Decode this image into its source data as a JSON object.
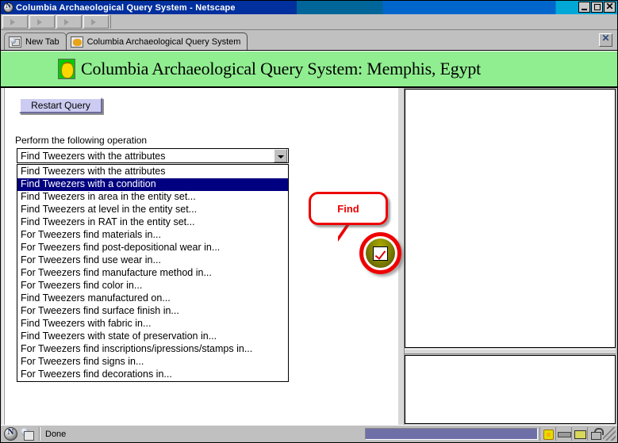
{
  "window": {
    "title": "Columbia Archaeological Query System - Netscape",
    "app_icon": "netscape-icon",
    "minimize_label": "",
    "maximize_label": "",
    "close_label": "✕"
  },
  "navbar": {
    "buttons": [
      "nav-button-1",
      "nav-button-2",
      "nav-button-3",
      "nav-button-4"
    ]
  },
  "tabs": [
    {
      "label": "New Tab",
      "icon": "new-tab-icon",
      "active": false
    },
    {
      "label": "Columbia Archaeological Query System",
      "icon": "scarab-icon",
      "active": true
    }
  ],
  "tab_close_label": "✕",
  "page": {
    "logo_icon": "scarab-logo-icon",
    "title": "Columbia Archaeological Query System: Memphis, Egypt",
    "header_bg": "#90ee90"
  },
  "form": {
    "restart_button": "Restart Query",
    "operation_label": "Perform the following operation",
    "selected_option": "Find Tweezers with the attributes",
    "dropdown_arrow_icon": "chevron-down-icon",
    "options": [
      {
        "label": "Find Tweezers with the attributes",
        "selected": false
      },
      {
        "label": "Find Tweezers with a condition",
        "selected": true
      },
      {
        "label": "Find Tweezers in area in the entity set...",
        "selected": false
      },
      {
        "label": "Find Tweezers at level in the entity set...",
        "selected": false
      },
      {
        "label": "Find Tweezers in RAT in the entity set...",
        "selected": false
      },
      {
        "label": "For Tweezers find materials in...",
        "selected": false
      },
      {
        "label": "For Tweezers find post-depositional wear in...",
        "selected": false
      },
      {
        "label": "For Tweezers find use wear in...",
        "selected": false
      },
      {
        "label": "For Tweezers find manufacture method in...",
        "selected": false
      },
      {
        "label": "For Tweezers find color in...",
        "selected": false
      },
      {
        "label": "Find Tweezers manufactured on...",
        "selected": false
      },
      {
        "label": "For Tweezers find surface finish in...",
        "selected": false
      },
      {
        "label": "Find Tweezers with fabric in...",
        "selected": false
      },
      {
        "label": "Find Tweezers with state of preservation in...",
        "selected": false
      },
      {
        "label": "For Tweezers find inscriptions/ipressions/stamps in...",
        "selected": false
      },
      {
        "label": "For Tweezers find signs in...",
        "selected": false
      },
      {
        "label": "For Tweezers find decorations in...",
        "selected": false
      }
    ]
  },
  "annotation": {
    "callout_text": "Find",
    "callout_color": "#ee0000",
    "target_icon": "checkmark-button-icon"
  },
  "statusbar": {
    "netscape_icon": "netscape-icon",
    "composer_icon": "composer-icon",
    "status_text": "Done",
    "tray_icons": [
      "warning-icon",
      "plugin-icon",
      "mail-icon",
      "lock-icon"
    ],
    "resize_grip": "resize-grip-icon"
  }
}
